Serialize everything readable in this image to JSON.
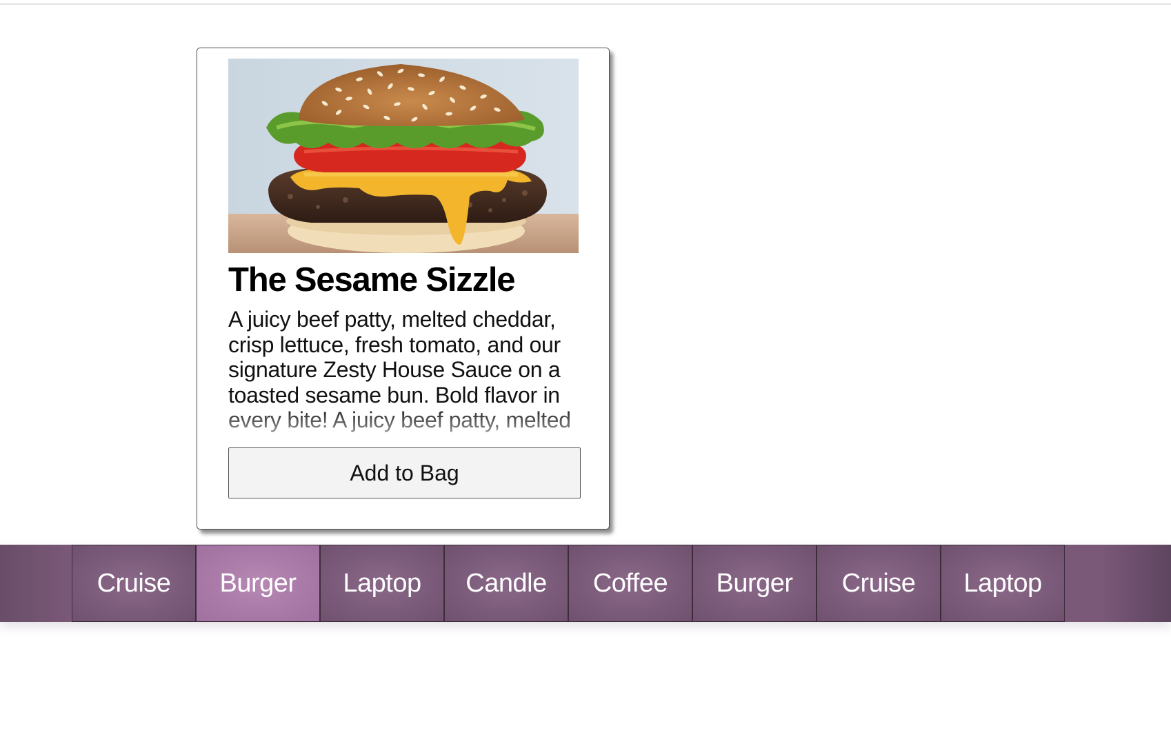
{
  "product": {
    "title": "The Sesame Sizzle",
    "description": "A juicy beef patty, melted cheddar, crisp lettuce, fresh tomato, and our signature Zesty House Sauce on a toasted sesame bun. Bold flavor in every bite! A juicy beef patty, melted cheddar, crisp lettuce, fresh tomato, and our signature Zesty House Sauce on a toasted sesame bun.",
    "image_subject": "burger-photo",
    "button_label": "Add to Bag"
  },
  "tabs": {
    "items": [
      {
        "label": "Cruise"
      },
      {
        "label": "Burger",
        "active": true
      },
      {
        "label": "Laptop"
      },
      {
        "label": "Candle"
      },
      {
        "label": "Coffee"
      },
      {
        "label": "Burger"
      },
      {
        "label": "Cruise"
      },
      {
        "label": "Laptop"
      }
    ],
    "active_index": 1,
    "colors": {
      "bar": "#7a5878",
      "tab": "#7a5a79",
      "active_tab": "#a878a6",
      "text": "#ffffff"
    }
  }
}
